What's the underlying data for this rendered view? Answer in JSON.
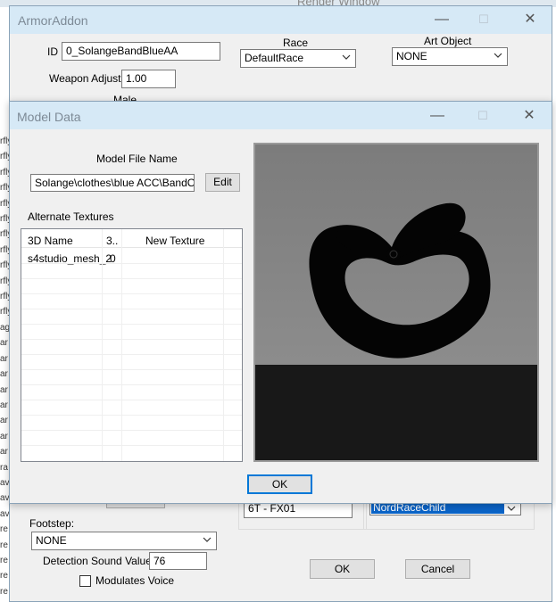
{
  "background": {
    "top_strip_text": "Render Window",
    "left_strip_texts": [
      "rfly",
      "rfly",
      "rfly",
      "rfly",
      "rfly",
      "rfly",
      "rfly",
      "rfly",
      "rfly",
      "rfly",
      "rfly",
      "rfly",
      "ag",
      "ar",
      "ar",
      "ar",
      "ar",
      "ar",
      "ar",
      "ar",
      "ar",
      "ra",
      "av",
      "av",
      "av",
      "re",
      "re",
      "re",
      "re",
      "re",
      "re",
      "re"
    ]
  },
  "armor_addon": {
    "title": "ArmorAddon",
    "id_label": "ID",
    "id_value": "0_SolangeBandBlueAA",
    "weapon_adjust_label": "Weapon Adjust",
    "weapon_adjust_value": "1.00",
    "race_label": "Race",
    "race_value": "DefaultRace",
    "art_object_label": "Art Object",
    "art_object_value": "NONE",
    "male_label": "Male",
    "footstep_label": "Footstep:",
    "footstep_value": "NONE",
    "detection_label": "Detection Sound Value",
    "detection_value": "76",
    "modulates_voice_label": "Modulates Voice",
    "partial_list_item": "6T - FX01",
    "selected_race": "NordRaceChild",
    "ok_label": "OK",
    "cancel_label": "Cancel"
  },
  "model_data": {
    "title": "Model Data",
    "model_file_name_label": "Model File Name",
    "model_file_name_value": "Solange\\clothes\\blue ACC\\BandOrig",
    "edit_label": "Edit",
    "alternate_textures_label": "Alternate Textures",
    "columns": [
      "3D Name",
      "3..",
      "New Texture"
    ],
    "rows": [
      {
        "name": "s4studio_mesh_2",
        "index": "0",
        "texture": ""
      }
    ],
    "ok_label": "OK"
  },
  "colors": {
    "titlebar": "#d6e9f6",
    "dialog_bg": "#f0f0f0",
    "preview_top": "#808080",
    "preview_floor": "#191919",
    "selection": "#0a64c8"
  }
}
